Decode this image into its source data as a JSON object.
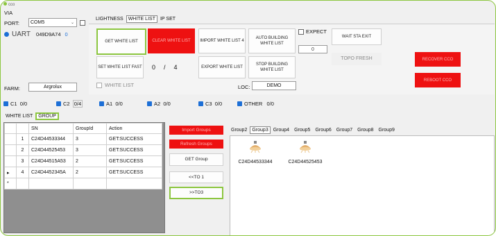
{
  "window": {
    "title": "cco"
  },
  "left": {
    "via_label": "VIA",
    "port_label": "PORT:",
    "port_value": "COM5",
    "uart_label": "UART",
    "uart_id": "049D9A74",
    "uart_count": "0",
    "farm_label": "FARM:",
    "farm_value": "Argrolux"
  },
  "top_tabs": [
    "LIGHTNESS",
    "WHITE LIST",
    "IP SET"
  ],
  "buttons": {
    "get_white_list": "GET WHITE LIST",
    "clear_white_list": "CLEAR WHITE LIST",
    "import_white_list": "IMPORT WHITE LIST 4",
    "auto_building": "AUTO BUILDING WHITE LIST",
    "wait_sta_exit": "WAIT STA EXIT",
    "set_white_list_fast": "SET WHITE LIST FAST",
    "export_white_list": "EXPORT WHITE LIST",
    "stop_building": "STOP BUILDING WHITE LIST",
    "topo_fresh": "TOPO FRESH",
    "recover_cco": "RECOVER CCO",
    "reboot_cco": "REBOOT CCO",
    "import_groups": "Import Groups",
    "refresh_groups": "Refresh Groups",
    "get_group": "GET Group",
    "to1": "<<TO 1",
    "to3": ">>TO3"
  },
  "counters": {
    "current": "0",
    "sep": "/",
    "total": "4"
  },
  "expect_label": "EXPECT",
  "expect_value": "0",
  "white_list_label": "WHITE LIST",
  "loc_label": "LOC:",
  "loc_value": "DEMO",
  "stats": [
    {
      "label": "C1",
      "value": "0/0"
    },
    {
      "label": "C2",
      "value": "0/4"
    },
    {
      "label": "A1",
      "value": "0/0"
    },
    {
      "label": "A2",
      "value": "0/0"
    },
    {
      "label": "C3",
      "value": "0/0"
    },
    {
      "label": "OTHER",
      "value": "0/0"
    }
  ],
  "sub_tabs": [
    "WHITE LIST",
    "GROUP"
  ],
  "table": {
    "headers": [
      "",
      "SN",
      "GroupId",
      "Action"
    ],
    "rows": [
      {
        "marker": "",
        "idx": "1",
        "sn": "C24D44533344",
        "group": "3",
        "action": "GET:SUCCESS"
      },
      {
        "marker": "",
        "idx": "2",
        "sn": "C24D44525453",
        "group": "3",
        "action": "GET:SUCCESS"
      },
      {
        "marker": "",
        "idx": "3",
        "sn": "C24D44515A53",
        "group": "2",
        "action": "GET:SUCCESS"
      },
      {
        "marker": "▸",
        "idx": "4",
        "sn": "C24D4452345A",
        "group": "2",
        "action": "GET:SUCCESS"
      },
      {
        "marker": "*",
        "idx": "",
        "sn": "",
        "group": "",
        "action": ""
      }
    ]
  },
  "group_tabs": [
    "Group2",
    "Group3",
    "Group4",
    "Group5",
    "Group6",
    "Group7",
    "Group8",
    "Group9"
  ],
  "lamps": [
    {
      "sn": "C24D44533344"
    },
    {
      "sn": "C24D44525453"
    }
  ],
  "colors": {
    "accent": "#8cc63f",
    "danger": "#ee1111",
    "status_blue": "#1d6fd6"
  }
}
